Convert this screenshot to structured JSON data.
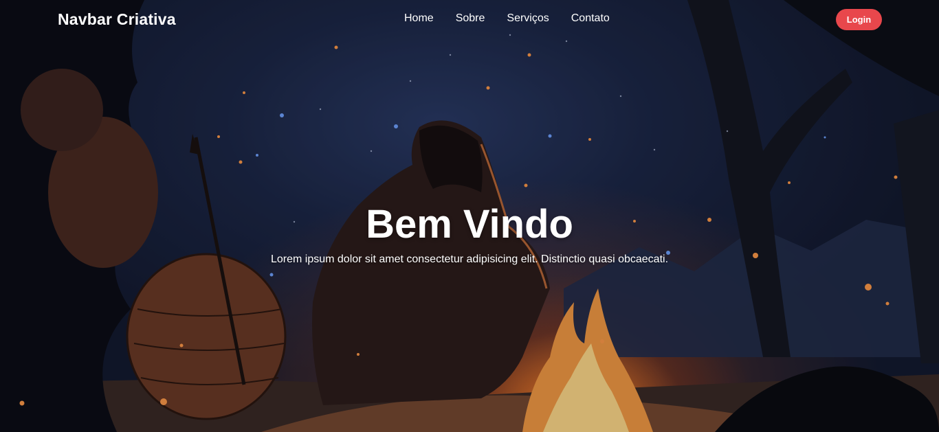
{
  "navbar": {
    "brand": "Navbar Criativa",
    "links": [
      {
        "label": "Home"
      },
      {
        "label": "Sobre"
      },
      {
        "label": "Serviços"
      },
      {
        "label": "Contato"
      }
    ],
    "login_label": "Login"
  },
  "hero": {
    "title": "Bem Vindo",
    "subtitle": "Lorem ipsum dolor sit amet consectetur adipisicing elit. Distinctio quasi obcaecati.",
    "background_description_icon": "campfire-illustration",
    "colors": {
      "login_button": "#e8474c",
      "text": "#ffffff",
      "sky": "#1c2747",
      "fire": "#f39a45"
    }
  }
}
